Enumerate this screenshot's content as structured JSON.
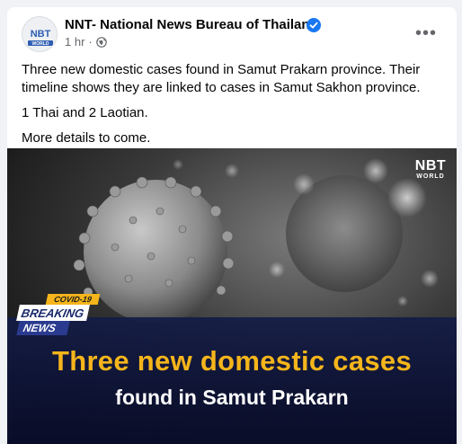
{
  "post": {
    "page_name": "NNT- National News Bureau of Thailand",
    "time": "1 hr",
    "separator": "·",
    "avatar_text_top": "NBT",
    "avatar_text_bottom": "WORLD",
    "more_label": "•••",
    "paragraphs": [
      "Three new domestic cases found in Samut Prakarn province. Their timeline shows they are linked to cases in Samut Sakhon province.",
      "1 Thai and 2 Laotian.",
      "More details to come."
    ],
    "icons": {
      "verified": "verified-badge-icon",
      "privacy": "globe-icon",
      "more": "more-options-icon"
    }
  },
  "media": {
    "logo_top": "NBT",
    "logo_bottom": "WORLD",
    "tag_covid": "COVID-19",
    "tag_breaking": "BREAKING",
    "tag_news": "NEWS",
    "headline_line1": "Three new domestic cases",
    "headline_line2": "found in Samut Prakarn"
  },
  "colors": {
    "accent_blue": "#1877f2",
    "headline_yellow": "#f5b51b",
    "band_navy": "#141c46",
    "meta_gray": "#65676b"
  }
}
